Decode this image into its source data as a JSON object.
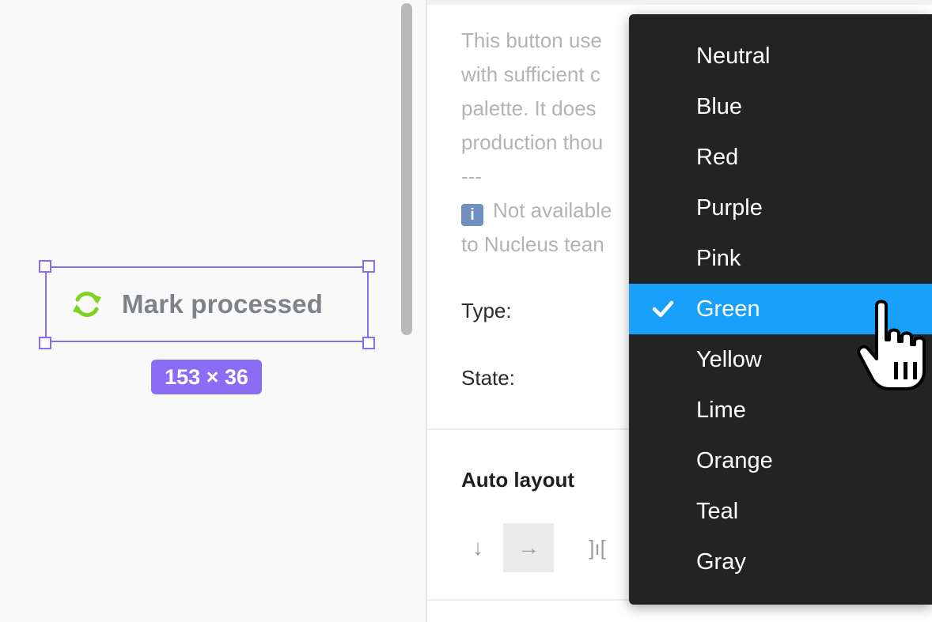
{
  "canvas": {
    "component_label": "Mark processed",
    "component_icon": "refresh-icon",
    "size_badge": "153 × 36",
    "selection_color": "#8a6cf5",
    "icon_color": "#7ed321"
  },
  "panel": {
    "description_lines": [
      "This button use",
      "with sufficient c",
      "palette. It does",
      "production thou",
      "---",
      "Not available",
      "to Nucleus tean"
    ],
    "info_icon": "info-icon",
    "type_label": "Type:",
    "state_label": "State:",
    "auto_layout_title": "Auto layout",
    "auto_layout_controls": {
      "vertical": "↓",
      "horizontal": "→",
      "spacing": "]ı["
    }
  },
  "dropdown": {
    "items": [
      "Neutral",
      "Blue",
      "Red",
      "Purple",
      "Pink",
      "Green",
      "Yellow",
      "Lime",
      "Orange",
      "Teal",
      "Gray"
    ],
    "selected": "Green",
    "highlight_color": "#18a0fb"
  }
}
